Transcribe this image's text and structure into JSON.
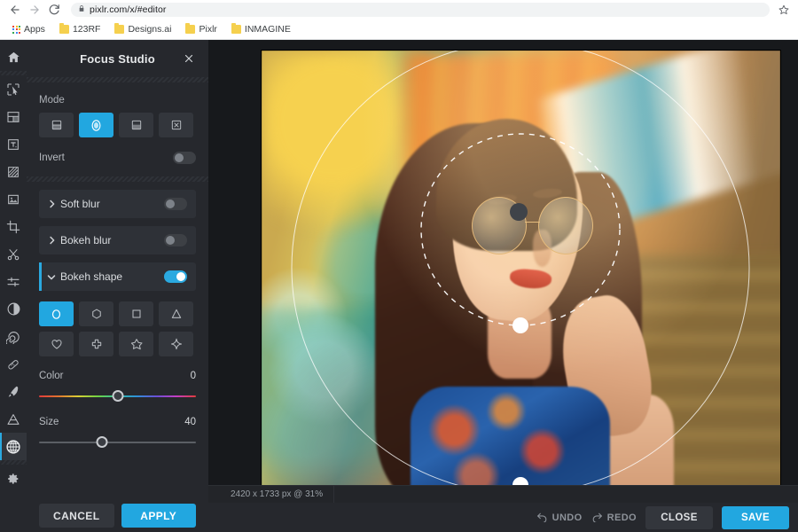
{
  "browser": {
    "back_icon": "arrow-left-icon",
    "forward_icon": "arrow-right-icon",
    "reload_icon": "reload-icon",
    "lock_icon": "lock-icon",
    "url": "pixlr.com/x/#editor",
    "star_icon": "star-icon",
    "bookmarks": [
      {
        "label": "Apps",
        "icon": "apps-grid-icon"
      },
      {
        "label": "123RF",
        "icon": "folder-icon"
      },
      {
        "label": "Designs.ai",
        "icon": "folder-icon"
      },
      {
        "label": "Pixlr",
        "icon": "folder-icon"
      },
      {
        "label": "INMAGINE",
        "icon": "folder-icon"
      }
    ]
  },
  "toolbar": {
    "tools": [
      {
        "name": "home-icon",
        "label": "Home"
      },
      {
        "name": "arrange-select-icon",
        "label": "Arrange"
      },
      {
        "name": "crop-marquee-icon",
        "label": "Marquee select"
      },
      {
        "name": "text-icon",
        "label": "Text"
      },
      {
        "name": "pattern-fill-icon",
        "label": "Pattern"
      },
      {
        "name": "image-icon",
        "label": "Add image"
      },
      {
        "name": "crop-icon",
        "label": "Crop"
      },
      {
        "name": "cut-scissors-icon",
        "label": "Cutout"
      },
      {
        "name": "adjust-sliders-icon",
        "label": "Adjust"
      },
      {
        "name": "contrast-icon",
        "label": "Effects"
      },
      {
        "name": "liquify-swirl-icon",
        "label": "Liquify"
      },
      {
        "name": "heal-icon",
        "label": "Heal"
      },
      {
        "name": "paintbrush-icon",
        "label": "Draw"
      },
      {
        "name": "shape-triangle-icon",
        "label": "Shape"
      },
      {
        "name": "focus-studio-globe-icon",
        "label": "Focus studio"
      },
      {
        "name": "settings-gear-icon",
        "label": "Settings"
      }
    ],
    "active_tool": "focus-studio-globe-icon"
  },
  "panel": {
    "title": "Focus Studio",
    "close_icon": "close-x-icon",
    "mode_label": "Mode",
    "modes": [
      {
        "name": "mode-linear-icon",
        "selected": false
      },
      {
        "name": "mode-radial-icon",
        "selected": true
      },
      {
        "name": "mode-mirror-icon",
        "selected": false
      },
      {
        "name": "mode-none-icon",
        "selected": false
      }
    ],
    "invert_label": "Invert",
    "invert_on": false,
    "sections": [
      {
        "label": "Soft blur",
        "open": false,
        "enabled": false,
        "chevron": "chevron-right-icon"
      },
      {
        "label": "Bokeh blur",
        "open": false,
        "enabled": false,
        "chevron": "chevron-right-icon"
      },
      {
        "label": "Bokeh shape",
        "open": true,
        "enabled": true,
        "chevron": "chevron-down-icon"
      }
    ],
    "shapes": [
      {
        "name": "shape-circle-icon",
        "selected": true
      },
      {
        "name": "shape-hexagon-icon",
        "selected": false
      },
      {
        "name": "shape-square-icon",
        "selected": false
      },
      {
        "name": "shape-triangle-icon",
        "selected": false
      },
      {
        "name": "shape-heart-icon",
        "selected": false
      },
      {
        "name": "shape-cross-icon",
        "selected": false
      },
      {
        "name": "shape-star-icon",
        "selected": false
      },
      {
        "name": "shape-sparkle-icon",
        "selected": false
      }
    ],
    "color": {
      "label": "Color",
      "value": "0",
      "percent": 50
    },
    "size": {
      "label": "Size",
      "value": "40",
      "percent": 40
    },
    "cancel_label": "CANCEL",
    "apply_label": "APPLY"
  },
  "status": {
    "dimensions": "2420 x 1733 px @ 31%"
  },
  "bottom": {
    "undo_label": "UNDO",
    "undo_icon": "undo-arrow-icon",
    "redo_label": "REDO",
    "redo_icon": "redo-arrow-icon",
    "close_label": "CLOSE",
    "save_label": "SAVE"
  },
  "colors": {
    "accent": "#22a7e0",
    "panel_bg": "#26282d",
    "stage_bg": "#17191c",
    "toolbar_bg": "#26282d"
  }
}
